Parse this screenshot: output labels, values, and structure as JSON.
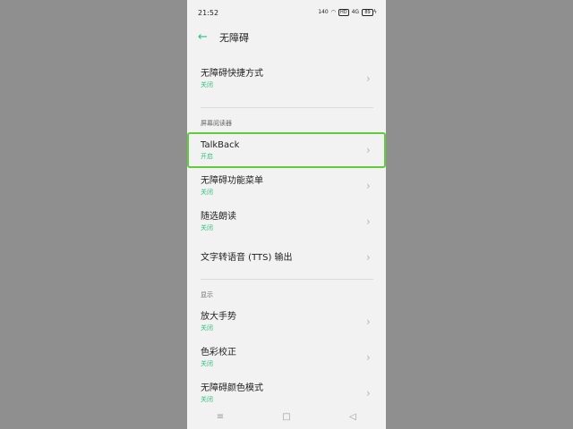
{
  "status": {
    "time": "21:52",
    "net_speed": "140",
    "sim_icon": "HD",
    "signal": "4G",
    "battery": "89"
  },
  "header": {
    "title": "无障碍"
  },
  "rows_top": [
    {
      "label": "无障碍快捷方式",
      "sub": "关闭"
    }
  ],
  "section_screen_reader": "屏幕阅读器",
  "screen_reader_rows": [
    {
      "label": "TalkBack",
      "sub": "开启"
    },
    {
      "label": "无障碍功能菜单",
      "sub": "关闭"
    },
    {
      "label": "随选朗读",
      "sub": "关闭"
    },
    {
      "label": "文字转语音 (TTS) 输出",
      "sub": ""
    }
  ],
  "section_display": "显示",
  "display_rows": [
    {
      "label": "放大手势",
      "sub": "关闭"
    },
    {
      "label": "色彩校正",
      "sub": "关闭"
    },
    {
      "label": "无障碍颜色模式",
      "sub": "关闭"
    }
  ],
  "colors": {
    "accent": "#2fbf7f",
    "highlight": "#5fcd3b"
  }
}
